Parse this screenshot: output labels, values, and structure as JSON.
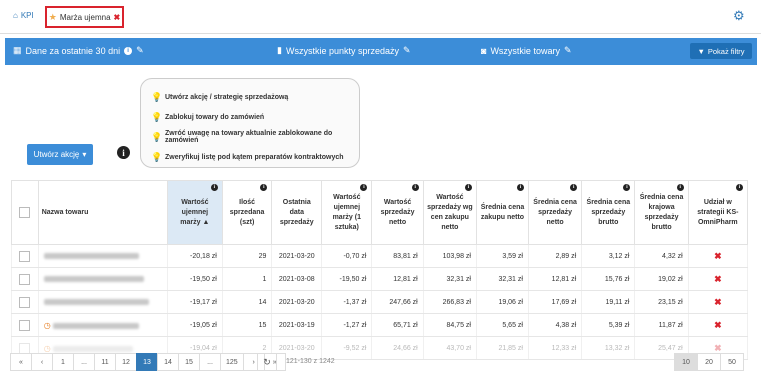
{
  "tabs": {
    "kpi_label": "KPI",
    "active_label": "Marża ujemna"
  },
  "filterbar": {
    "date_label": "Dane za ostatnie 30 dni",
    "points_label": "Wszystkie punkty sprzedaży",
    "goods_label": "Wszystkie towary",
    "filters_button": "Pokaż filtry",
    "bg_color": "#3c8dd8"
  },
  "actions": [
    "Utwórz akcję / strategię sprzedażową",
    "Zablokuj towary do zamówień",
    "Zwróć uwagę na towary aktualnie zablokowane do zamówień",
    "Zweryfikuj listę pod kątem preparatów kontraktowych"
  ],
  "create_action_button": "Utwórz akcję",
  "table": {
    "headers": [
      "Nazwa towaru",
      "Wartość ujemnej marży",
      "Ilość sprzedana (szt)",
      "Ostatnia data sprzedaży",
      "Wartość ujemnej marży (1 sztuka)",
      "Wartość sprzedaży netto",
      "Wartość sprzedaży wg cen zakupu netto",
      "Średnia cena zakupu netto",
      "Średnia cena sprzedaży netto",
      "Średnia cena sprzedaży brutto",
      "Średnia cena krajowa sprzedaży brutto",
      "Udział w strategii KS-OmniPharm"
    ],
    "rows": [
      [
        "-20,18 zł",
        "29",
        "2021-03-20",
        "-0,70 zł",
        "83,81 zł",
        "103,98 zł",
        "3,59 zł",
        "2,89 zł",
        "3,12 zł",
        "4,32 zł"
      ],
      [
        "-19,50 zł",
        "1",
        "2021-03-08",
        "-19,50 zł",
        "12,81 zł",
        "32,31 zł",
        "32,31 zł",
        "12,81 zł",
        "15,76 zł",
        "19,02 zł"
      ],
      [
        "-19,17 zł",
        "14",
        "2021-03-20",
        "-1,37 zł",
        "247,66 zł",
        "266,83 zł",
        "19,06 zł",
        "17,69 zł",
        "19,11 zł",
        "23,15 zł"
      ],
      [
        "-19,05 zł",
        "15",
        "2021-03-19",
        "-1,27 zł",
        "65,71 zł",
        "84,75 zł",
        "5,65 zł",
        "4,38 zł",
        "5,39 zł",
        "11,87 zł"
      ],
      [
        "-19,04 zł",
        "2",
        "2021-03-20",
        "-9,52 zł",
        "24,66 zł",
        "43,70 zł",
        "21,85 zł",
        "12,33 zł",
        "13,32 zł",
        "25,47 zł"
      ]
    ]
  },
  "pager": {
    "pages": [
      "«",
      "‹",
      "1",
      "...",
      "11",
      "12",
      "13",
      "14",
      "15",
      "...",
      "125",
      "›",
      "»"
    ],
    "active": "13",
    "range_text": "121-130 z 1242",
    "sizes": [
      "10",
      "20",
      "50"
    ],
    "active_size": "10"
  }
}
